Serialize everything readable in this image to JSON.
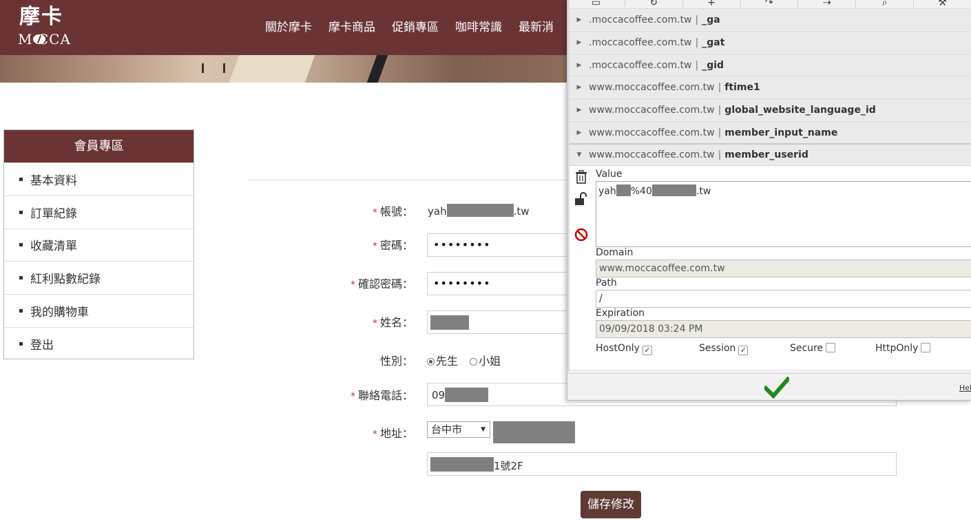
{
  "site": {
    "logo_cn": "摩卡",
    "logo_en": "M CCA"
  },
  "nav": {
    "items": [
      "關於摩卡",
      "摩卡商品",
      "促銷專區",
      "咖啡常識",
      "最新消"
    ]
  },
  "sidebar": {
    "title": "會員專區",
    "items": [
      {
        "label": "基本資料"
      },
      {
        "label": "訂單紀錄"
      },
      {
        "label": "收藏清單"
      },
      {
        "label": "紅利點數紀錄"
      },
      {
        "label": "我的購物車"
      },
      {
        "label": "登出"
      }
    ]
  },
  "form": {
    "required_mark": "*",
    "account_label": "帳號：",
    "account_prefix": "yah",
    "account_suffix": ".tw",
    "password_label": "密碼：",
    "password_value": "••••••••",
    "confirm_label": "確認密碼：",
    "confirm_value": "••••••••",
    "name_label": "姓名：",
    "gender_label": "性別：",
    "gender_male": "先生",
    "gender_female": "小姐",
    "phone_label": "聯絡電話：",
    "phone_prefix": "09",
    "address_label": "地址：",
    "city_selected": "台中市",
    "address_suffix": "1號2F",
    "save_label": "儲存修改"
  },
  "cookie_editor": {
    "cookies": [
      {
        "domain": ".moccacoffee.com.tw",
        "sep": "|",
        "name": "_ga"
      },
      {
        "domain": ".moccacoffee.com.tw",
        "sep": "|",
        "name": "_gat"
      },
      {
        "domain": ".moccacoffee.com.tw",
        "sep": "|",
        "name": "_gid"
      },
      {
        "domain": "www.moccacoffee.com.tw",
        "sep": "|",
        "name": "ftime1"
      },
      {
        "domain": "www.moccacoffee.com.tw",
        "sep": "|",
        "name": "global_website_language_id"
      },
      {
        "domain": "www.moccacoffee.com.tw",
        "sep": "|",
        "name": "member_input_name"
      },
      {
        "domain": "www.moccacoffee.com.tw",
        "sep": "|",
        "name": "member_userid"
      }
    ],
    "detail": {
      "value_label": "Value",
      "value_prefix": "yah",
      "value_mid": "%40",
      "value_suffix": ".tw",
      "domain_label": "Domain",
      "domain_value": "www.moccacoffee.com.tw",
      "path_label": "Path",
      "path_value": "/",
      "expiration_label": "Expiration",
      "expiration_value": "09/09/2018 03:24 PM",
      "hostonly_label": "HostOnly",
      "session_label": "Session",
      "secure_label": "Secure",
      "httponly_label": "HttpOnly",
      "hostonly_checked": true,
      "session_checked": true,
      "secure_checked": false,
      "httponly_checked": false
    },
    "help_label": "Hel"
  },
  "colors": {
    "brand": "#6b3434",
    "save_button": "#5e3a32",
    "ok_check": "#1e8a1e",
    "delete_cookie": "#cc0000"
  }
}
